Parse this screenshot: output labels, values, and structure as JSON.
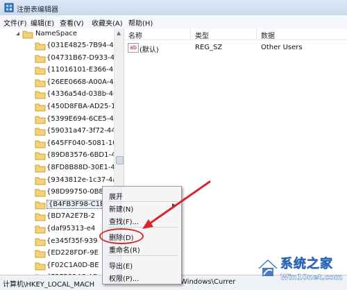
{
  "window": {
    "title": "注册表编辑器"
  },
  "menubar": {
    "items": [
      "文件(F)",
      "编辑(E)",
      "查看(V)",
      "收藏夹(A)",
      "帮助(H)"
    ]
  },
  "tree": {
    "root": "NameSpace",
    "items": [
      "{031E4825-7B94-4dc",
      "{04731B67-D933-450",
      "{11016101-E366-4D2",
      "{26EE0668-A00A-44D",
      "{4336a54d-038b-468",
      "{450D8FBA-AD25-11",
      "{5399E694-6CE5-4D6",
      "{59031a47-3f72-44a7",
      "{645FF040-5081-101I",
      "{89D83576-6BD1-4c8",
      "{8FD8B88D-30E1-4F2",
      "{9343812e-1c37-4a4",
      "{98D99750-0B8A-4c5",
      "{B4FB3F98-C1EA-428",
      "{BD7A2E7B-2",
      "{daf95313-e4",
      "{e345f35f-939",
      "{ED228FDF-9E",
      "{F02C1A0D-BE",
      "{F3F5824C-AD"
    ],
    "selected_index": 13
  },
  "values_header": {
    "name": "名称",
    "type": "类型",
    "data": "数据"
  },
  "values": [
    {
      "name": "(默认)",
      "type": "REG_SZ",
      "data": "Other Users",
      "icon": "ab-icon"
    }
  ],
  "context_menu": {
    "items": [
      {
        "label": "展开",
        "submenu": false
      },
      {
        "label": "新建(N)",
        "submenu": true
      },
      {
        "label": "查找(F)...",
        "submenu": false
      },
      {
        "label": "删除(D)",
        "submenu": false
      },
      {
        "label": "重命名(R)",
        "submenu": false
      },
      {
        "label": "导出(E)",
        "submenu": false
      },
      {
        "label": "权限(P)...",
        "submenu": false
      }
    ],
    "highlighted": "删除(D)"
  },
  "statusbar": {
    "path_left": "计算机\\HKEY_LOCAL_MACH",
    "path_right": "Windows\\Currer"
  },
  "watermark": {
    "text": "系统之家",
    "url": "Win10net.com"
  },
  "annotation": {
    "color": "#d8262c"
  }
}
